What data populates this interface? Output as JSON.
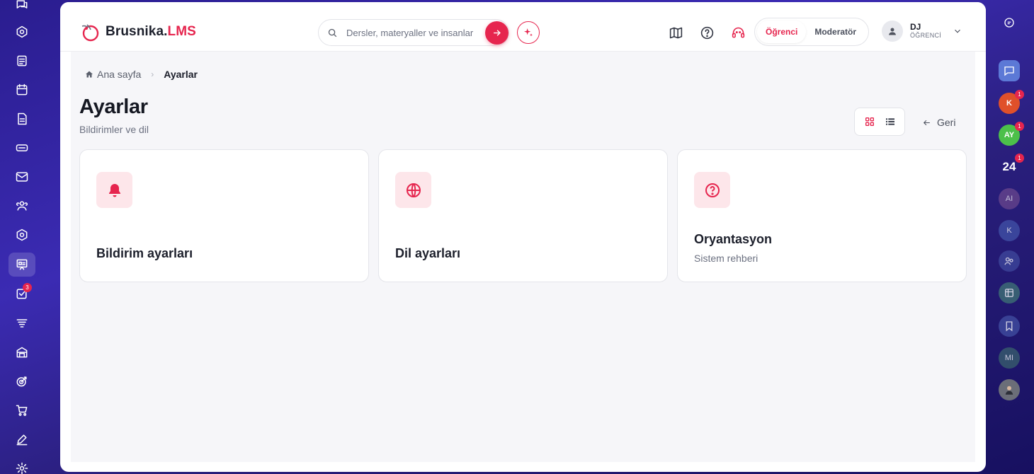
{
  "app": {
    "logo_text": "Brusnika.",
    "logo_accent": "LMS"
  },
  "search": {
    "placeholder": "Dersler, materyaller ve insanlar"
  },
  "roles": {
    "student": "Öğrenci",
    "moderator": "Moderatör",
    "active": "Öğrenci"
  },
  "user": {
    "initials": "DJ",
    "role": "ÖĞRENCİ"
  },
  "breadcrumb": {
    "home": "Ana sayfa",
    "current": "Ayarlar"
  },
  "page": {
    "title": "Ayarlar",
    "subtitle": "Bildirimler ve dil",
    "back_label": "Geri"
  },
  "cards": [
    {
      "title": "Bildirim ayarları",
      "subtitle": "",
      "icon": "bell-icon"
    },
    {
      "title": "Dil ayarları",
      "subtitle": "",
      "icon": "globe-icon"
    },
    {
      "title": "Oryantasyon",
      "subtitle": "Sistem rehberi",
      "icon": "question-circle-icon"
    }
  ],
  "left_rail": {
    "tasks_badge": "3"
  },
  "right_rail": {
    "items": [
      {
        "label": "K",
        "badge": "1",
        "color": "#e0502a"
      },
      {
        "label": "AY",
        "badge": "1",
        "color": "#4cc04a"
      },
      {
        "label": "24",
        "badge": "1"
      },
      {
        "label": "AI"
      },
      {
        "label": "K"
      },
      {
        "label": "MI"
      }
    ]
  },
  "colors": {
    "accent": "#e6254e",
    "accent_soft": "#fde6ea"
  }
}
